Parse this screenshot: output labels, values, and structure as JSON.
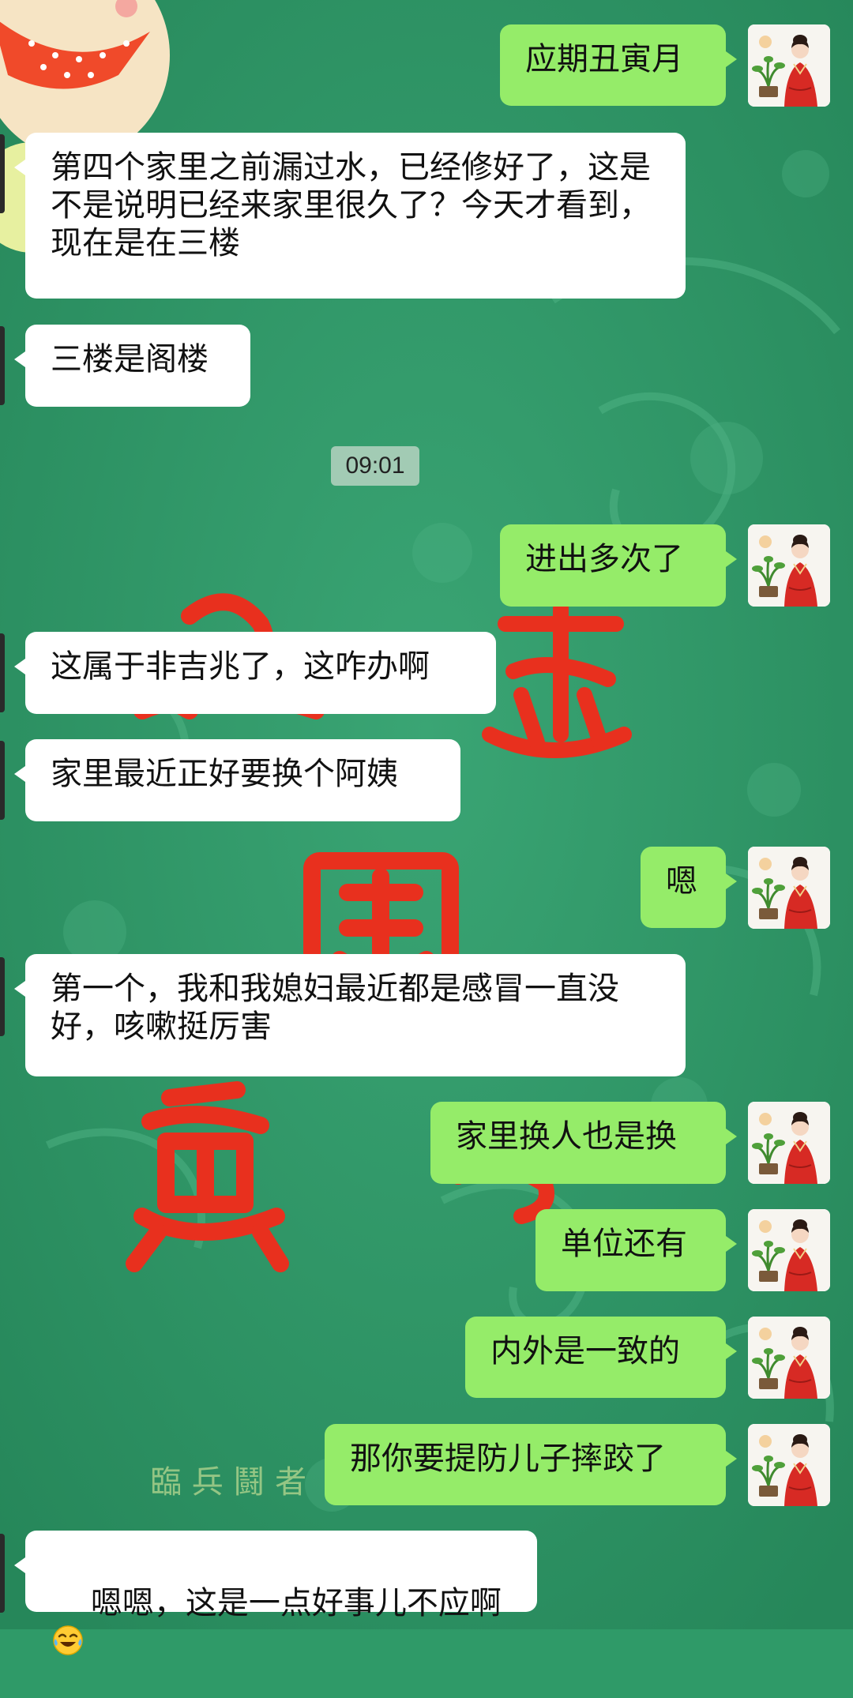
{
  "chat": {
    "messages": [
      {
        "side": "right",
        "text": "应期丑寅月"
      },
      {
        "side": "left",
        "text": "第四个家里之前漏过水，已经修好了，这是不是说明已经来家里很久了？今天才看到，现在是在三楼"
      },
      {
        "side": "left",
        "text": "三楼是阁楼"
      },
      {
        "side": "right",
        "text": "进出多次了"
      },
      {
        "side": "left",
        "text": "这属于非吉兆了，这咋办啊"
      },
      {
        "side": "left",
        "text": "家里最近正好要换个阿姨"
      },
      {
        "side": "right",
        "text": "嗯"
      },
      {
        "side": "left",
        "text": "第一个，我和我媳妇最近都是感冒一直没好，咳嗽挺厉害"
      },
      {
        "side": "right",
        "text": "家里换人也是换"
      },
      {
        "side": "right",
        "text": "单位还有"
      },
      {
        "side": "right",
        "text": "内外是一致的"
      },
      {
        "side": "right",
        "text": "那你要提防儿子摔跤了"
      },
      {
        "side": "left",
        "text": "嗯嗯，这是一点好事儿不应啊",
        "emoji": "crying-laughing-emoji"
      }
    ],
    "timestamp": "09:01"
  },
  "theme": {
    "background": "#2f9a68",
    "incoming_bubble": "#ffffff",
    "outgoing_bubble": "#95ec69",
    "background_art_color": "#e8301e"
  },
  "background_art_text": "臨 兵 鬪 者"
}
